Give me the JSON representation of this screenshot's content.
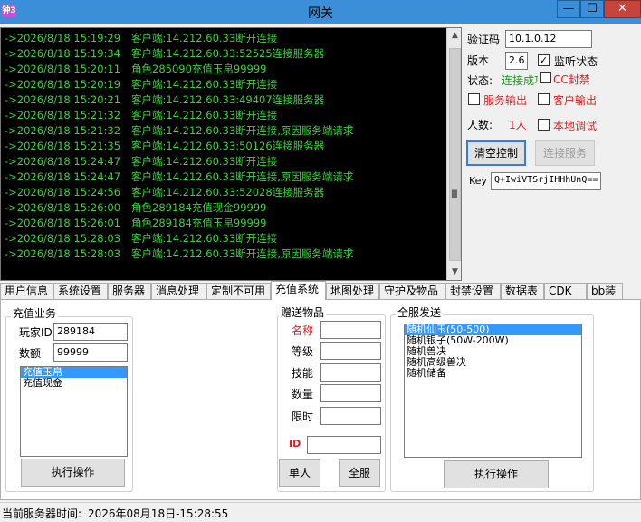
{
  "window": {
    "icon_text": "钟3",
    "title": "网关",
    "minimize": "—",
    "maximize": "☐",
    "close": "✕"
  },
  "log": [
    {
      "time": "->2026/8/18 15:19:29",
      "msg": "客户端:14.212.60.33断开连接"
    },
    {
      "time": "->2026/8/18 15:19:34",
      "msg": "客户端:14.212.60.33:52525连接服务器"
    },
    {
      "time": "->2026/8/18 15:20:11",
      "msg": "角色285090充值玉帛99999"
    },
    {
      "time": "->2026/8/18 15:20:19",
      "msg": "客户端:14.212.60.33断开连接"
    },
    {
      "time": "->2026/8/18 15:20:21",
      "msg": "客户端:14.212.60.33:49407连接服务器"
    },
    {
      "time": "->2026/8/18 15:21:32",
      "msg": "客户端:14.212.60.33断开连接"
    },
    {
      "time": "->2026/8/18 15:21:32",
      "msg": "客户端:14.212.60.33断开连接,原因服务端请求"
    },
    {
      "time": "->2026/8/18 15:21:35",
      "msg": "客户端:14.212.60.33:50126连接服务器"
    },
    {
      "time": "->2026/8/18 15:24:47",
      "msg": "客户端:14.212.60.33断开连接"
    },
    {
      "time": "->2026/8/18 15:24:47",
      "msg": "客户端:14.212.60.33断开连接,原因服务端请求"
    },
    {
      "time": "->2026/8/18 15:24:56",
      "msg": "客户端:14.212.60.33:52028连接服务器"
    },
    {
      "time": "->2026/8/18 15:26:00",
      "msg": "角色289184充值现金99999"
    },
    {
      "time": "->2026/8/18 15:26:01",
      "msg": "角色289184充值玉帛99999"
    },
    {
      "time": "->2026/8/18 15:28:03",
      "msg": "客户端:14.212.60.33断开连接"
    },
    {
      "time": "->2026/8/18 15:28:03",
      "msg": "客户端:14.212.60.33断开连接,原因服务端请求"
    }
  ],
  "right_panel": {
    "verify_label": "验证码",
    "verify_value": "10.1.0.12",
    "version_label": "版本",
    "version_value": "2.6",
    "monitor_label": "监听状态",
    "monitor_checked": "✓",
    "status_label": "状态:",
    "status_value": "连接成功",
    "cc_label": "CC封禁",
    "service_output_label": "服务输出",
    "client_output_label": "客户输出",
    "count_label": "人数:",
    "count_value": "1人",
    "local_debug_label": "本地调试",
    "clear_button": "清空控制",
    "connect_button": "连接服务",
    "key_label": "Key",
    "key_value": "Q+IwiVTSrjIHHhUnQ=="
  },
  "tabs": [
    "用户信息",
    "系统设置",
    "服务器",
    "消息处理",
    "定制不可用",
    "充值系统",
    "地图处理",
    "守护及物品",
    "封禁设置",
    "数据表",
    "CDK",
    "bb装"
  ],
  "active_tab": "充值系统",
  "recharge": {
    "title": "充值业务",
    "player_label": "玩家ID",
    "player_value": "289184",
    "amount_label": "数额",
    "amount_value": "99999",
    "types": [
      "充值玉帛",
      "充值现金"
    ],
    "selected_type": "充值玉帛",
    "execute": "执行操作"
  },
  "gift": {
    "title": "赠送物品",
    "name_label": "名称",
    "level_label": "等级",
    "skill_label": "技能",
    "qty_label": "数量",
    "limit_label": "限时",
    "id_label": "ID",
    "single_button": "单人",
    "all_button": "全服"
  },
  "broadcast": {
    "title": "全服发送",
    "items": [
      "随机仙玉(50-500)",
      "随机银子(50W-200W)",
      "随机兽决",
      "随机高级兽决",
      "随机储备"
    ],
    "selected": "随机仙玉(50-500)",
    "execute": "执行操作"
  },
  "status_bar": {
    "label": "当前服务器时间:",
    "value": "2026年08月18日-15:28:55"
  }
}
